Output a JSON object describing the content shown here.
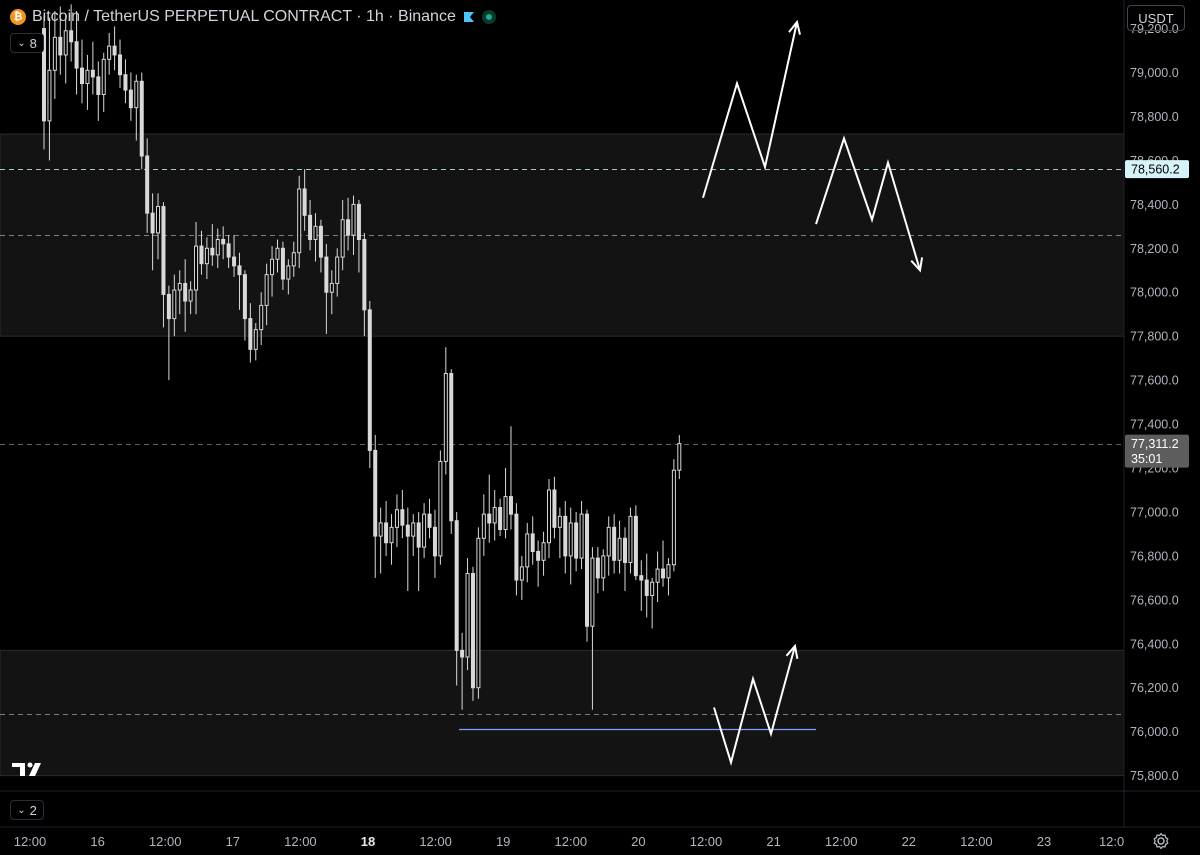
{
  "header": {
    "symbol_icon": "bitcoin-icon",
    "title": "Bitcoin / TetherUS PERPETUAL CONTRACT · 1h · Binance",
    "indicator_count": "8",
    "bottom_count": "2"
  },
  "currency": "USDT",
  "colors": {
    "background": "#000000",
    "candle": "#d9d9d9",
    "zone": "#131313",
    "axis_text": "#b2b5be",
    "hline": "#7aa2ff",
    "current_price_bg": "#5d5d5d",
    "marked_price_bg": "#d6f4f7"
  },
  "chart_data": {
    "type": "candlestick",
    "title": "Bitcoin / TetherUS PERPETUAL CONTRACT · 1h · Binance",
    "ylim": [
      75730,
      79330
    ],
    "y_ticks": [
      79200,
      79000,
      78800,
      78600,
      78400,
      78200,
      78000,
      77800,
      77600,
      77400,
      77200,
      77000,
      76800,
      76600,
      76400,
      76200,
      76000,
      75800
    ],
    "x_ticks": [
      "12:00",
      "16",
      "12:00",
      "17",
      "12:00",
      "18",
      "12:00",
      "19",
      "12:00",
      "20",
      "12:00",
      "21",
      "12:00",
      "22",
      "12:00",
      "23",
      "12:0"
    ],
    "bold_x_ticks": [
      "18"
    ],
    "last_price": "77,311.2",
    "countdown": "35:01",
    "marked_price": "78,560.2",
    "zones": [
      {
        "low": 77800,
        "high": 78720
      },
      {
        "low": 75800,
        "high": 76370
      }
    ],
    "dashed_levels": [
      78560.2,
      78260,
      77311.2,
      76080
    ],
    "support_line": {
      "price": 76010
    },
    "projected_paths": [
      [
        [
          0,
          78430
        ],
        [
          1,
          78950
        ],
        [
          2,
          78570
        ],
        [
          3,
          79230
        ]
      ],
      [
        [
          0,
          78310
        ],
        [
          1,
          78700
        ],
        [
          2,
          78330
        ],
        [
          3,
          78590
        ],
        [
          4,
          78100
        ]
      ],
      [
        [
          0,
          76110
        ],
        [
          1,
          75860
        ],
        [
          2,
          76240
        ],
        [
          3,
          75990
        ],
        [
          4,
          76390
        ]
      ]
    ],
    "candles_ohlc": [
      [
        79200,
        79260,
        78650,
        78780
      ],
      [
        78780,
        79250,
        78600,
        79010
      ],
      [
        79010,
        79280,
        78880,
        79160
      ],
      [
        79160,
        79300,
        78990,
        79080
      ],
      [
        79080,
        79260,
        78950,
        79190
      ],
      [
        79190,
        79310,
        79050,
        79140
      ],
      [
        79140,
        79280,
        78900,
        79020
      ],
      [
        79020,
        79150,
        78860,
        78950
      ],
      [
        78950,
        79080,
        78830,
        79010
      ],
      [
        79010,
        79140,
        78900,
        78980
      ],
      [
        78980,
        79050,
        78780,
        78900
      ],
      [
        78900,
        79090,
        78820,
        79060
      ],
      [
        79060,
        79180,
        78990,
        79120
      ],
      [
        79120,
        79210,
        79010,
        79080
      ],
      [
        79080,
        79150,
        78930,
        78990
      ],
      [
        78990,
        79060,
        78860,
        78920
      ],
      [
        78920,
        79000,
        78780,
        78840
      ],
      [
        78840,
        78990,
        78690,
        78960
      ],
      [
        78960,
        79000,
        78560,
        78620
      ],
      [
        78620,
        78700,
        78270,
        78360
      ],
      [
        78360,
        78450,
        78100,
        78270
      ],
      [
        78270,
        78450,
        78150,
        78390
      ],
      [
        78390,
        78410,
        77840,
        77990
      ],
      [
        77990,
        78030,
        77600,
        77880
      ],
      [
        77880,
        78080,
        77800,
        78010
      ],
      [
        78010,
        78100,
        77900,
        78040
      ],
      [
        78040,
        78150,
        77820,
        77960
      ],
      [
        77960,
        78050,
        77900,
        78010
      ],
      [
        78010,
        78320,
        77900,
        78210
      ],
      [
        78210,
        78280,
        78080,
        78130
      ],
      [
        78130,
        78250,
        78060,
        78200
      ],
      [
        78200,
        78310,
        78120,
        78170
      ],
      [
        78170,
        78290,
        78110,
        78240
      ],
      [
        78240,
        78300,
        78150,
        78220
      ],
      [
        78220,
        78260,
        78110,
        78160
      ],
      [
        78160,
        78260,
        78070,
        78120
      ],
      [
        78120,
        78180,
        77920,
        78080
      ],
      [
        78080,
        78100,
        77780,
        77880
      ],
      [
        77880,
        77950,
        77680,
        77740
      ],
      [
        77740,
        77860,
        77690,
        77830
      ],
      [
        77830,
        78000,
        77760,
        77940
      ],
      [
        77940,
        78130,
        77850,
        78080
      ],
      [
        78080,
        78210,
        77980,
        78150
      ],
      [
        78150,
        78240,
        78090,
        78200
      ],
      [
        78200,
        78230,
        78010,
        78060
      ],
      [
        78060,
        78150,
        77990,
        78120
      ],
      [
        78120,
        78230,
        78070,
        78180
      ],
      [
        78180,
        78530,
        78110,
        78470
      ],
      [
        78470,
        78560,
        78280,
        78350
      ],
      [
        78350,
        78420,
        78190,
        78240
      ],
      [
        78240,
        78360,
        78140,
        78300
      ],
      [
        78300,
        78330,
        78090,
        78160
      ],
      [
        78160,
        78220,
        77810,
        78000
      ],
      [
        78000,
        78100,
        77900,
        78040
      ],
      [
        78040,
        78200,
        77980,
        78160
      ],
      [
        78160,
        78420,
        78100,
        78330
      ],
      [
        78330,
        78430,
        78190,
        78260
      ],
      [
        78260,
        78440,
        78170,
        78400
      ],
      [
        78400,
        78420,
        78090,
        78240
      ],
      [
        78240,
        78270,
        77800,
        77920
      ],
      [
        77920,
        77960,
        77200,
        77280
      ],
      [
        77280,
        77350,
        76700,
        76890
      ],
      [
        76890,
        77020,
        76720,
        76950
      ],
      [
        76950,
        77050,
        76800,
        76860
      ],
      [
        76860,
        76990,
        76760,
        76930
      ],
      [
        76930,
        77080,
        76840,
        77010
      ],
      [
        77010,
        77100,
        76880,
        76940
      ],
      [
        76940,
        77020,
        76640,
        76890
      ],
      [
        76890,
        76990,
        76800,
        76950
      ],
      [
        76950,
        77000,
        76640,
        76840
      ],
      [
        76840,
        77040,
        76790,
        76990
      ],
      [
        76990,
        77060,
        76880,
        76930
      ],
      [
        76930,
        77010,
        76700,
        76800
      ],
      [
        76800,
        77280,
        76760,
        77230
      ],
      [
        77230,
        77750,
        77170,
        77630
      ],
      [
        77630,
        77650,
        76900,
        76960
      ],
      [
        76960,
        77000,
        76210,
        76370
      ],
      [
        76370,
        76450,
        76100,
        76340
      ],
      [
        76340,
        76790,
        76280,
        76720
      ],
      [
        76720,
        76750,
        76140,
        76200
      ],
      [
        76200,
        76930,
        76150,
        76880
      ],
      [
        76880,
        77080,
        76800,
        76990
      ],
      [
        76990,
        77170,
        76860,
        76950
      ],
      [
        76950,
        77100,
        76870,
        77020
      ],
      [
        77020,
        77060,
        76890,
        76920
      ],
      [
        76920,
        77200,
        76880,
        77070
      ],
      [
        77070,
        77390,
        76920,
        76990
      ],
      [
        76990,
        77040,
        76620,
        76690
      ],
      [
        76690,
        76800,
        76600,
        76750
      ],
      [
        76750,
        76950,
        76680,
        76900
      ],
      [
        76900,
        76980,
        76760,
        76820
      ],
      [
        76820,
        76870,
        76660,
        76780
      ],
      [
        76780,
        76910,
        76710,
        76860
      ],
      [
        76860,
        77150,
        76790,
        77100
      ],
      [
        77100,
        77160,
        76880,
        76930
      ],
      [
        76930,
        77020,
        76790,
        76980
      ],
      [
        76980,
        77050,
        76720,
        76800
      ],
      [
        76800,
        77020,
        76670,
        76950
      ],
      [
        76950,
        77000,
        76730,
        76790
      ],
      [
        76790,
        77050,
        76740,
        76990
      ],
      [
        76990,
        77010,
        76410,
        76480
      ],
      [
        76480,
        76840,
        76100,
        76790
      ],
      [
        76790,
        76840,
        76630,
        76700
      ],
      [
        76700,
        76830,
        76640,
        76800
      ],
      [
        76800,
        76980,
        76710,
        76930
      ],
      [
        76930,
        76990,
        76720,
        76780
      ],
      [
        76780,
        76960,
        76720,
        76880
      ],
      [
        76880,
        76930,
        76640,
        76770
      ],
      [
        76770,
        77020,
        76720,
        76980
      ],
      [
        76980,
        77030,
        76690,
        76710
      ],
      [
        76710,
        76780,
        76550,
        76690
      ],
      [
        76690,
        76810,
        76520,
        76620
      ],
      [
        76620,
        76700,
        76470,
        76680
      ],
      [
        76680,
        76820,
        76590,
        76740
      ],
      [
        76740,
        76870,
        76660,
        76700
      ],
      [
        76700,
        76790,
        76620,
        76760
      ],
      [
        76760,
        77240,
        76730,
        77190
      ],
      [
        77190,
        77350,
        77150,
        77311.2
      ]
    ]
  }
}
